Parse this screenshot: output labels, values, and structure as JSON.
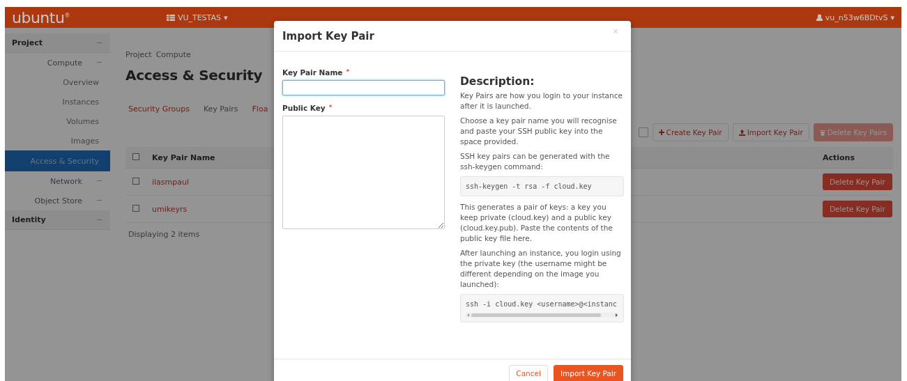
{
  "top_bar": {
    "logo": "ubuntu",
    "logo_mark": "®",
    "project_menu": "VU_TESTAS",
    "project_caret": "▾",
    "user_menu": "vu_n53w6BDtvS",
    "user_caret": "▾"
  },
  "sidebar": {
    "items": [
      {
        "label": "Project",
        "kind": "section",
        "selected": false
      },
      {
        "label": "Compute",
        "kind": "group",
        "selected": false
      },
      {
        "label": "Overview",
        "kind": "item",
        "selected": false
      },
      {
        "label": "Instances",
        "kind": "item",
        "selected": false
      },
      {
        "label": "Volumes",
        "kind": "item",
        "selected": false
      },
      {
        "label": "Images",
        "kind": "item",
        "selected": false
      },
      {
        "label": "Access & Security",
        "kind": "item",
        "selected": true
      },
      {
        "label": "Network",
        "kind": "group",
        "selected": false
      },
      {
        "label": "Object Store",
        "kind": "group",
        "selected": false
      },
      {
        "label": "Identity",
        "kind": "section",
        "selected": false
      }
    ]
  },
  "main": {
    "breadcrumb": [
      "Project",
      "Compute"
    ],
    "title": "Access & Security",
    "tabs": [
      {
        "label": "Security Groups",
        "selected": false
      },
      {
        "label": "Key Pairs",
        "selected": true
      },
      {
        "label": "Floa",
        "selected": false
      }
    ],
    "toolbar": {
      "filter_checked": false,
      "create": "Create Key Pair",
      "import": "Import Key Pair",
      "delete": "Delete Key Pairs",
      "delete_disabled": true
    },
    "table": {
      "select_all_checked": false,
      "columns": [
        "Key Pair Name",
        "Actions"
      ],
      "rows": [
        {
          "checked": false,
          "name": "ilasmpaul",
          "action": "Delete Key Pair"
        },
        {
          "checked": false,
          "name": "umikeyrs",
          "action": "Delete Key Pair"
        }
      ],
      "footer": "Displaying 2 items"
    }
  },
  "modal": {
    "title": "Import Key Pair",
    "close": "×",
    "fields": [
      {
        "label": "Key Pair Name",
        "required_mark": "*",
        "kind": "input"
      },
      {
        "label": "Public Key",
        "required_mark": "*",
        "kind": "textarea"
      }
    ],
    "description": {
      "heading": "Description:",
      "blocks": [
        {
          "kind": "text",
          "text": "Key Pairs are how you login to your instance after it is launched."
        },
        {
          "kind": "text",
          "text": "Choose a key pair name you will recognise and paste your SSH public key into the space provided."
        },
        {
          "kind": "text",
          "text": "SSH key pairs can be generated with the ssh-keygen command:"
        },
        {
          "kind": "code",
          "text": "ssh-keygen -t rsa -f cloud.key"
        },
        {
          "kind": "text",
          "text": "This generates a pair of keys: a key you keep private (cloud.key) and a public key (cloud.key.pub). Paste the contents of the public key file here."
        },
        {
          "kind": "text",
          "text": "After launching an instance, you login using the private key (the username might be different depending on the image you launched):"
        },
        {
          "kind": "code",
          "text": "ssh -i cloud.key <username>@<instanc",
          "scroll": true
        }
      ]
    },
    "buttons": [
      {
        "label": "Cancel",
        "kind": "secondary"
      },
      {
        "label": "Import Key Pair",
        "kind": "primary"
      }
    ]
  }
}
